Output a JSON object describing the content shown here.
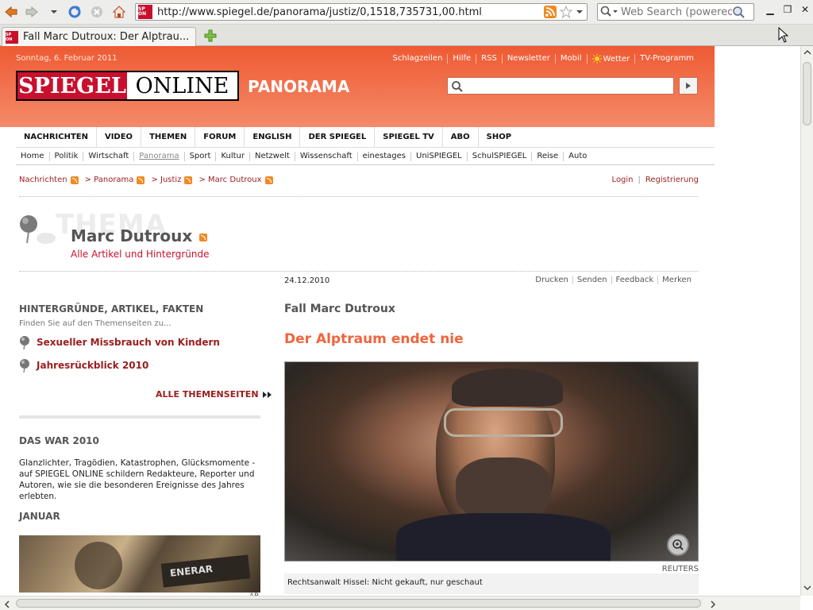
{
  "browser": {
    "url": "http://www.spiegel.de/panorama/justiz/0,1518,735731,00.html",
    "search_placeholder": "Web Search (powered",
    "tab_title": "Fall Marc Dutroux: Der Alptrau...",
    "favicon_text": "SP ON"
  },
  "header": {
    "date": "Sonntag, 6. Februar 2011",
    "links": [
      "Schlagzeilen",
      "Hilfe",
      "RSS",
      "Newsletter",
      "Mobil",
      "Wetter",
      "TV-Programm"
    ],
    "logo_red": "SPIEGEL",
    "logo_black": "ONLINE",
    "section": "PANORAMA"
  },
  "main_nav": [
    "NACHRICHTEN",
    "VIDEO",
    "THEMEN",
    "FORUM",
    "ENGLISH",
    "DER SPIEGEL",
    "SPIEGEL TV",
    "ABO",
    "SHOP"
  ],
  "sub_nav": [
    "Home",
    "Politik",
    "Wirtschaft",
    "Panorama",
    "Sport",
    "Kultur",
    "Netzwelt",
    "Wissenschaft",
    "einestages",
    "UniSPIEGEL",
    "SchulSPIEGEL",
    "Reise",
    "Auto"
  ],
  "sub_nav_active": "Panorama",
  "breadcrumb": [
    "Nachrichten",
    "> Panorama",
    "> Justiz",
    "> Marc Dutroux"
  ],
  "auth": {
    "login": "Login",
    "register": "Registrierung",
    "separator": "|"
  },
  "thema": {
    "watermark": "THEMA",
    "title": "Marc Dutroux",
    "subtitle": "Alle Artikel und Hintergründe"
  },
  "left": {
    "heading": "HINTERGRÜNDE, ARTIKEL, FAKTEN",
    "hint": "Finden Sie auf den Themenseiten zu...",
    "themes": [
      "Sexueller Missbrauch von Kindern",
      "Jahresrückblick 2010"
    ],
    "all_themes": "ALLE THEMENSEITEN",
    "das_war_heading": "DAS WAR 2010",
    "das_war_body": "Glanzlichter, Tragödien, Katastrophen, Glücksmomente - auf SPIEGEL ONLINE schildern Redakteure, Reporter und Autoren, wie sie die besonderen Ereignisse des Jahres erlebten.",
    "januar": "JANUAR",
    "januar_credit": "AP"
  },
  "article": {
    "date": "24.12.2010",
    "tools": [
      "Drucken",
      "Senden",
      "Feedback",
      "Merken"
    ],
    "kicker": "Fall Marc Dutroux",
    "headline": "Der Alptraum endet nie",
    "photo_credit": "REUTERS",
    "caption": "Rechtsanwalt Hissel: Nicht gekauft, nur geschaut"
  },
  "colors": {
    "header_orange": "#ee5a33",
    "link_red": "#9b1d1d",
    "headline_orange": "#f0643c"
  }
}
